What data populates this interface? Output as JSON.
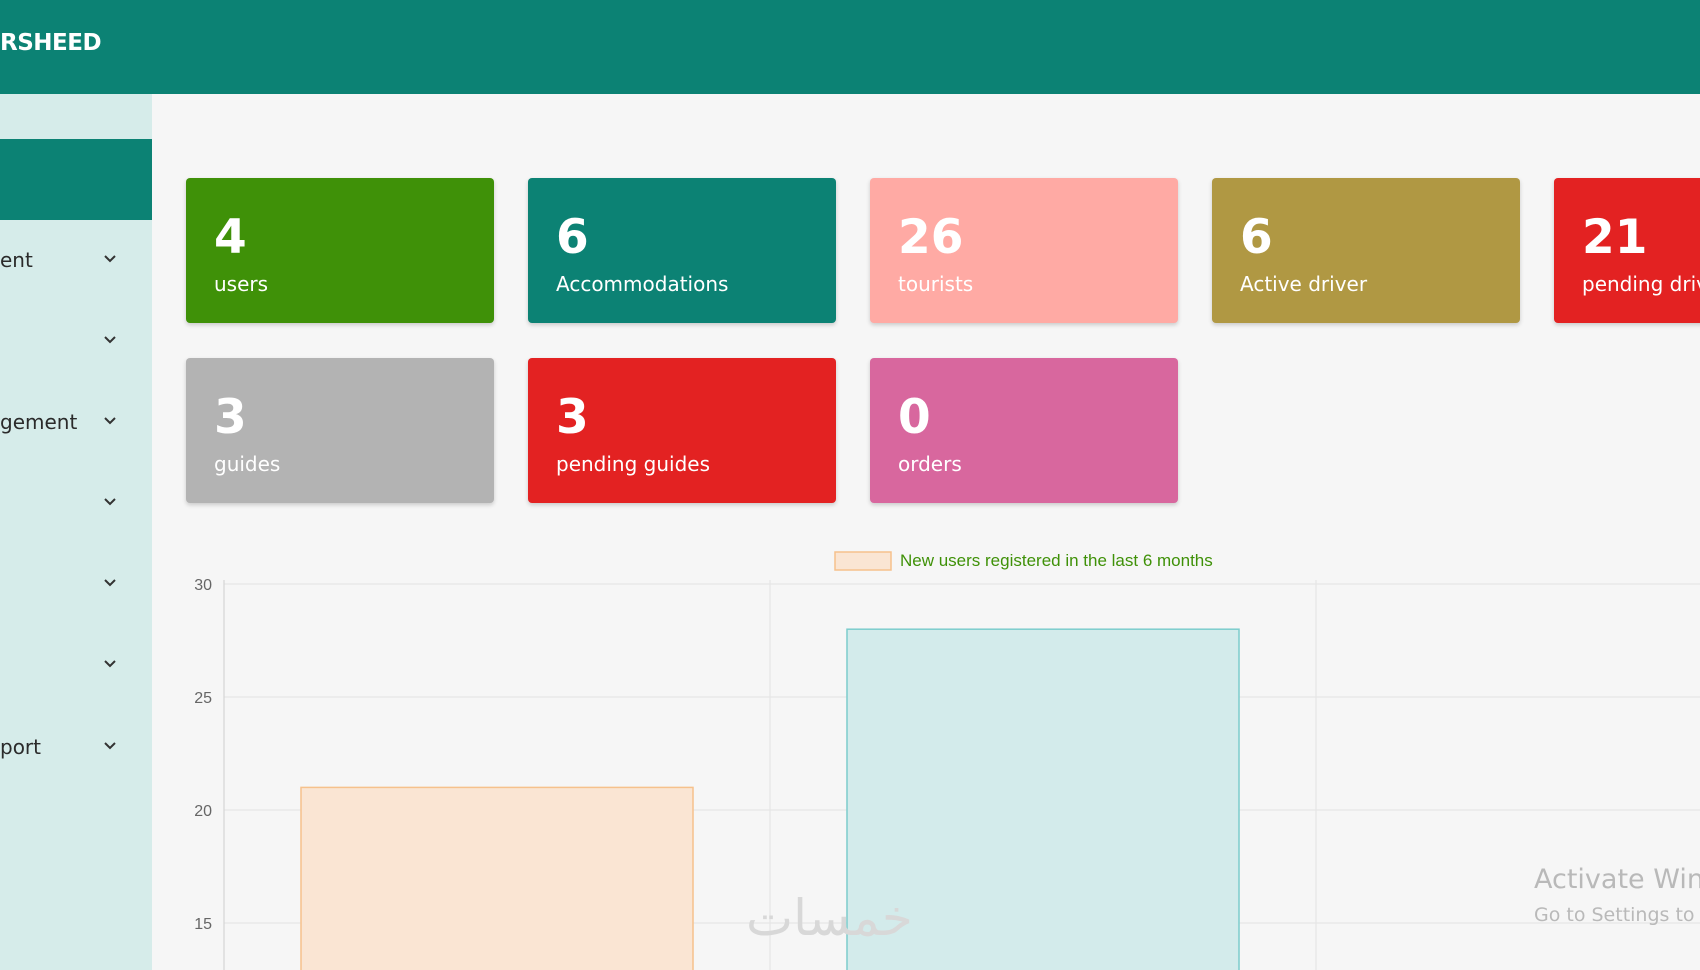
{
  "header": {
    "brand": "RSHEED"
  },
  "sidebar": {
    "items": [
      {
        "label": "ent"
      },
      {
        "label": ""
      },
      {
        "label": "gement"
      },
      {
        "label": ""
      },
      {
        "label": ""
      },
      {
        "label": ""
      },
      {
        "label": "port"
      }
    ]
  },
  "stats": [
    {
      "value": "4",
      "label": "users",
      "color": "#3f9108"
    },
    {
      "value": "6",
      "label": "Accommodations",
      "color": "#0c8274"
    },
    {
      "value": "26",
      "label": "tourists",
      "color": "#ffaaa4"
    },
    {
      "value": "6",
      "label": "Active driver",
      "color": "#b09843"
    },
    {
      "value": "21",
      "label": "pending driv",
      "color": "#e32222"
    },
    {
      "value": "3",
      "label": "guides",
      "color": "#b3b3b3"
    },
    {
      "value": "3",
      "label": "pending guides",
      "color": "#e32222"
    },
    {
      "value": "0",
      "label": "orders",
      "color": "#d8679e"
    }
  ],
  "chart_data": {
    "type": "bar",
    "legend": "New users registered in the last 6 months",
    "legend_placement": "top",
    "ylim": [
      13,
      31
    ],
    "yticks": [
      30,
      25,
      20,
      15
    ],
    "grid": true,
    "series": [
      {
        "name": "New users registered in the last 6 months",
        "values": [
          21,
          28
        ]
      }
    ],
    "bar_colors": [
      {
        "fill": "#fae5d3",
        "stroke": "#f6c18c"
      },
      {
        "fill": "#d3ebeb",
        "stroke": "#7ccccc"
      }
    ],
    "legend_color": {
      "fill": "#fae5d3",
      "stroke": "#f6c18c"
    },
    "legend_text_color": "#3f9108"
  },
  "watermark": {
    "title": "Activate Winc",
    "subtitle": "Go to Settings to a",
    "logo_text": "خمسات"
  }
}
